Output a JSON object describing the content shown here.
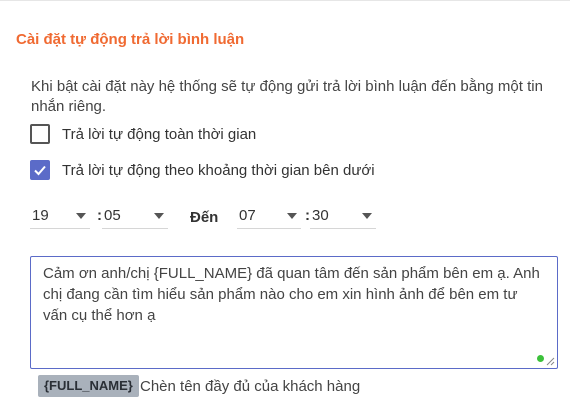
{
  "section": {
    "title": "Cài đặt tự động trả lời bình luận",
    "description": "Khi bật cài đặt này hệ thống sẽ tự động gửi trả lời bình luận đến bằng một tin nhắn riêng."
  },
  "options": [
    {
      "label": "Trả lời tự động toàn thời gian",
      "checked": false
    },
    {
      "label": "Trả lời tự động theo khoảng thời gian bên dưới",
      "checked": true
    }
  ],
  "time_range": {
    "from_hour": "19",
    "from_minute": "05",
    "separator": ":",
    "to_label": "Đến",
    "to_hour": "07",
    "to_minute": "30"
  },
  "message": {
    "text": "Cảm ơn anh/chị {FULL_NAME} đã quan tâm đến sản phẩm bên em ạ. Anh chị đang cần tìm hiểu sản phẩm nào cho em xin hình ảnh để bên em tư vấn cụ thể hơn ạ"
  },
  "variable": {
    "tag": "{FULL_NAME}",
    "description": "Chèn tên đầy đủ của khách hàng"
  },
  "colors": {
    "title": "#f06a32",
    "accent": "#5b6bc8",
    "status_dot": "#3cc13b",
    "tag_bg": "#a9b1bb"
  }
}
